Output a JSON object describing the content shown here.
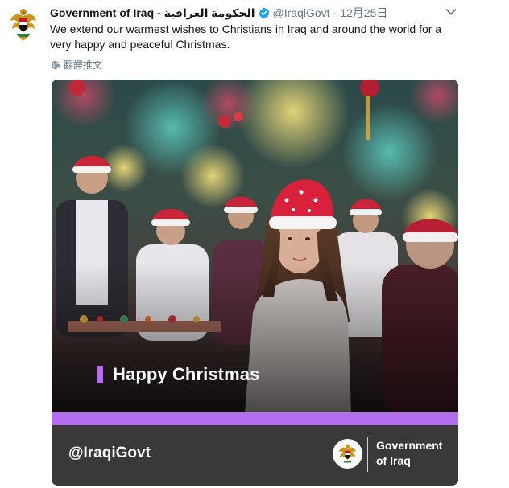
{
  "tweet": {
    "display_name": "Government of Iraq - الحكومة العراقية",
    "handle": "@IraqiGovt",
    "separator": "·",
    "date": "12月25日",
    "text": "We extend our warmest wishes to Christians in Iraq and around the world for a very happy and peaceful Christmas.",
    "translate_label": "翻譯推文"
  },
  "media": {
    "caption": "Happy Christmas",
    "footer_handle": "@IraqiGovt",
    "footer_name_line1": "Government",
    "footer_name_line2": "of Iraq"
  },
  "colors": {
    "accent_purple": "#b36ef0",
    "footer_bg": "#3a3838",
    "verified_blue": "#1da1f2",
    "muted_text": "#657786"
  },
  "icons": {
    "avatar": "iraq-emblem-icon",
    "verified": "verified-badge-icon",
    "caret": "chevron-down-icon",
    "translate": "globe-icon"
  }
}
